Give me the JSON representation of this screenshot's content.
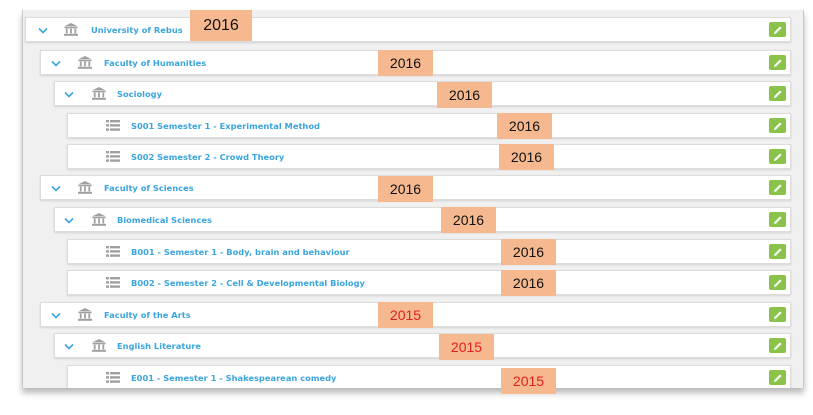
{
  "tree": {
    "nodes": [
      {
        "label": "University of Rebus",
        "icon": "institution-icon",
        "year": "2016",
        "expanded": true
      },
      {
        "label": "Faculty of Humanities",
        "icon": "institution-icon",
        "year": "2016",
        "expanded": true
      },
      {
        "label": "Sociology",
        "icon": "institution-icon",
        "year": "2016",
        "expanded": true
      },
      {
        "label": "S001 Semester 1 - Experimental Method",
        "icon": "list-icon",
        "year": "2016"
      },
      {
        "label": "S002 Semester 2 - Crowd Theory",
        "icon": "list-icon",
        "year": "2016"
      },
      {
        "label": "Faculty of Sciences",
        "icon": "institution-icon",
        "year": "2016",
        "expanded": true
      },
      {
        "label": "Biomedical Sciences",
        "icon": "institution-icon",
        "year": "2016",
        "expanded": true
      },
      {
        "label": "B001 - Semester 1 - Body, brain and behaviour",
        "icon": "list-icon",
        "year": "2016"
      },
      {
        "label": "B002 - Semester 2 - Cell & Developmental Biology",
        "icon": "list-icon",
        "year": "2016"
      },
      {
        "label": "Faculty of the Arts",
        "icon": "institution-icon",
        "year": "2015",
        "expanded": true
      },
      {
        "label": "English Literature",
        "icon": "institution-icon",
        "year": "2015",
        "expanded": true
      },
      {
        "label": "E001 - Semester 1 - Shakespearean comedy",
        "icon": "list-icon",
        "year": "2015"
      }
    ]
  },
  "colors": {
    "label": "#3aa5de",
    "edit_button": "#8bc34a",
    "year_highlight": "#f6b98f",
    "year_2016_text": "#111111",
    "year_2015_text": "#e0201b"
  }
}
